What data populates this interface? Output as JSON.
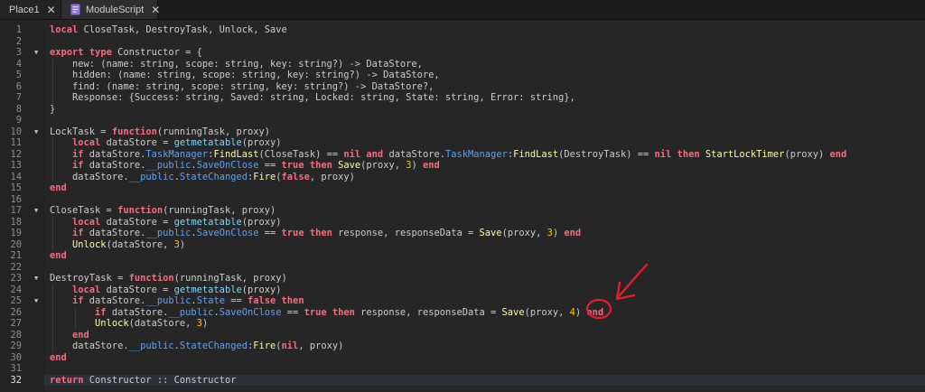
{
  "tabs": [
    {
      "label": "Place1",
      "close": "✕"
    },
    {
      "label": "ModuleScript",
      "close": "✕"
    }
  ],
  "editor": {
    "active_line": 32,
    "lines": [
      {
        "n": 1,
        "fold": false,
        "code": "local CloseTask, DestroyTask, Unlock, Save"
      },
      {
        "n": 2,
        "fold": false,
        "code": ""
      },
      {
        "n": 3,
        "fold": true,
        "code": "export type Constructor = {"
      },
      {
        "n": 4,
        "fold": false,
        "code": "    new: (name: string, scope: string, key: string?) -> DataStore,"
      },
      {
        "n": 5,
        "fold": false,
        "code": "    hidden: (name: string, scope: string, key: string?) -> DataStore,"
      },
      {
        "n": 6,
        "fold": false,
        "code": "    find: (name: string, scope: string, key: string?) -> DataStore?,"
      },
      {
        "n": 7,
        "fold": false,
        "code": "    Response: {Success: string, Saved: string, Locked: string, State: string, Error: string},"
      },
      {
        "n": 8,
        "fold": false,
        "code": "}"
      },
      {
        "n": 9,
        "fold": false,
        "code": ""
      },
      {
        "n": 10,
        "fold": true,
        "code": "LockTask = function(runningTask, proxy)"
      },
      {
        "n": 11,
        "fold": false,
        "code": "    local dataStore = getmetatable(proxy)"
      },
      {
        "n": 12,
        "fold": false,
        "code": "    if dataStore.TaskManager:FindLast(CloseTask) == nil and dataStore.TaskManager:FindLast(DestroyTask) == nil then StartLockTimer(proxy) end"
      },
      {
        "n": 13,
        "fold": false,
        "code": "    if dataStore.__public.SaveOnClose == true then Save(proxy, 3) end"
      },
      {
        "n": 14,
        "fold": false,
        "code": "    dataStore.__public.StateChanged:Fire(false, proxy)"
      },
      {
        "n": 15,
        "fold": false,
        "code": "end"
      },
      {
        "n": 16,
        "fold": false,
        "code": ""
      },
      {
        "n": 17,
        "fold": true,
        "code": "CloseTask = function(runningTask, proxy)"
      },
      {
        "n": 18,
        "fold": false,
        "code": "    local dataStore = getmetatable(proxy)"
      },
      {
        "n": 19,
        "fold": false,
        "code": "    if dataStore.__public.SaveOnClose == true then response, responseData = Save(proxy, 3) end"
      },
      {
        "n": 20,
        "fold": false,
        "code": "    Unlock(dataStore, 3)"
      },
      {
        "n": 21,
        "fold": false,
        "code": "end"
      },
      {
        "n": 22,
        "fold": false,
        "code": ""
      },
      {
        "n": 23,
        "fold": true,
        "code": "DestroyTask = function(runningTask, proxy)"
      },
      {
        "n": 24,
        "fold": false,
        "code": "    local dataStore = getmetatable(proxy)"
      },
      {
        "n": 25,
        "fold": true,
        "code": "    if dataStore.__public.State == false then"
      },
      {
        "n": 26,
        "fold": false,
        "code": "        if dataStore.__public.SaveOnClose == true then response, responseData = Save(proxy, 4) end"
      },
      {
        "n": 27,
        "fold": false,
        "code": "        Unlock(dataStore, 3)"
      },
      {
        "n": 28,
        "fold": false,
        "code": "    end"
      },
      {
        "n": 29,
        "fold": false,
        "code": "    dataStore.__public.StateChanged:Fire(nil, proxy)"
      },
      {
        "n": 30,
        "fold": false,
        "code": "end"
      },
      {
        "n": 31,
        "fold": false,
        "code": ""
      },
      {
        "n": 32,
        "fold": false,
        "code": "return Constructor :: Constructor"
      }
    ]
  },
  "colors": {
    "annotation": "#e0202a",
    "tab_icon": "#8d6fe0",
    "current_line": "#2c3039"
  },
  "icons": {
    "tab_script": "module-script-icon",
    "fold": "fold-arrow-icon",
    "tab_close": "close-icon"
  }
}
